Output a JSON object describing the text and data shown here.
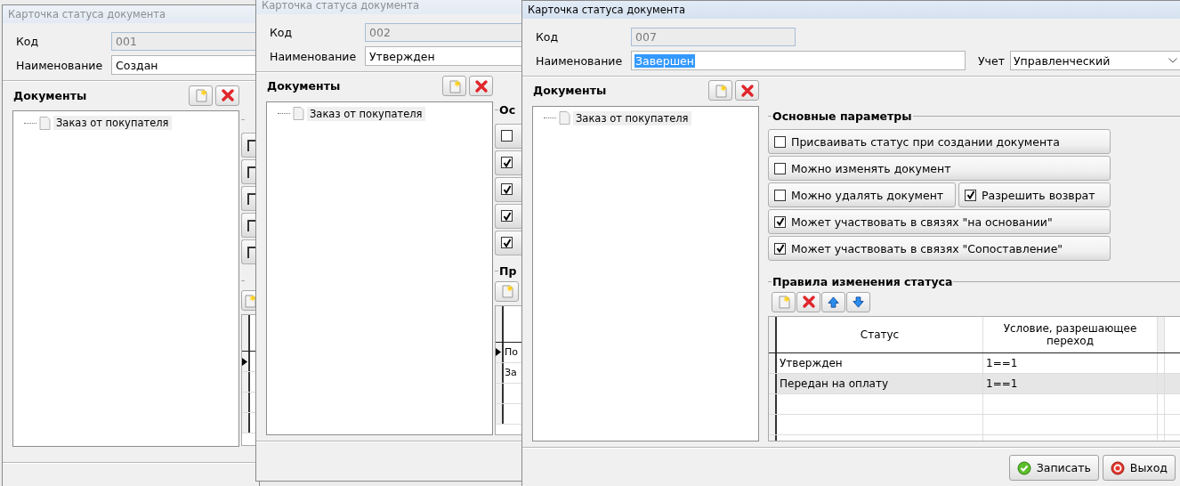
{
  "windows": [
    {
      "kind": "partial",
      "active": false,
      "title": "Карточка статуса документа",
      "code_label": "Код",
      "code": "001",
      "name_label": "Наименование",
      "name": "Создан",
      "documents_title": "Документы",
      "documents": [
        {
          "label": "Заказ от покупателя"
        }
      ],
      "fragment": {
        "options": [
          {
            "kind": "cut"
          },
          {
            "kind": "cut"
          },
          {
            "kind": "cut"
          },
          {
            "kind": "cut"
          },
          {
            "kind": "cut"
          }
        ],
        "rows": [
          {
            "current": true
          },
          {
            "current": false
          }
        ]
      }
    },
    {
      "kind": "partial",
      "active": false,
      "title": "Карточка статуса документа",
      "code_label": "Код",
      "code": "002",
      "name_label": "Наименование",
      "name": "Утвержден",
      "documents_title": "Документы",
      "documents": [
        {
          "label": "Заказ от покупателя"
        }
      ],
      "fragment": {
        "group_title": "Ос",
        "options": [
          {
            "kind": "checkbox",
            "checked": false
          },
          {
            "kind": "checkbox",
            "checked": true
          },
          {
            "kind": "checkbox",
            "checked": true
          },
          {
            "kind": "checkbox",
            "checked": true
          },
          {
            "kind": "checkbox",
            "checked": true
          }
        ],
        "rules_title": "Пр",
        "rows": [
          {
            "current": true,
            "cell": "По"
          },
          {
            "current": false,
            "cell": "За"
          }
        ]
      }
    },
    {
      "kind": "full",
      "active": true,
      "title": "Карточка статуса документа",
      "code_label": "Код",
      "code": "007",
      "name_label": "Наименование",
      "name": "Завершен",
      "name_selected": true,
      "accounting_label": "Учет",
      "accounting": "Управленческий",
      "documents_title": "Документы",
      "documents": [
        {
          "label": "Заказ от покупателя"
        }
      ],
      "main_params_title": "Основные параметры",
      "option_rows": [
        [
          {
            "label": "Присваивать статус при создании документа",
            "checked": false
          }
        ],
        [
          {
            "label": "Можно изменять документ",
            "checked": false
          }
        ],
        [
          {
            "label": "Можно удалять документ",
            "checked": false
          },
          {
            "label": "Разрешить возврат",
            "checked": true
          }
        ],
        [
          {
            "label": "Может участвовать в связях \"на основании\"",
            "checked": true
          }
        ],
        [
          {
            "label": "Может участвовать в связях \"Сопоставление\"",
            "checked": true
          }
        ]
      ],
      "rules_title": "Правила изменения статуса",
      "table": {
        "columns": [
          "Статус",
          "Условие, разрешающее переход"
        ],
        "rows": [
          {
            "cells": [
              "Утвержден",
              "1==1"
            ],
            "selected": false
          },
          {
            "cells": [
              "Передан на оплату",
              "1==1"
            ],
            "selected": true
          }
        ]
      },
      "buttons": [
        {
          "label": "Записать",
          "kind": "save"
        },
        {
          "label": "Выход",
          "kind": "exit"
        }
      ]
    }
  ]
}
